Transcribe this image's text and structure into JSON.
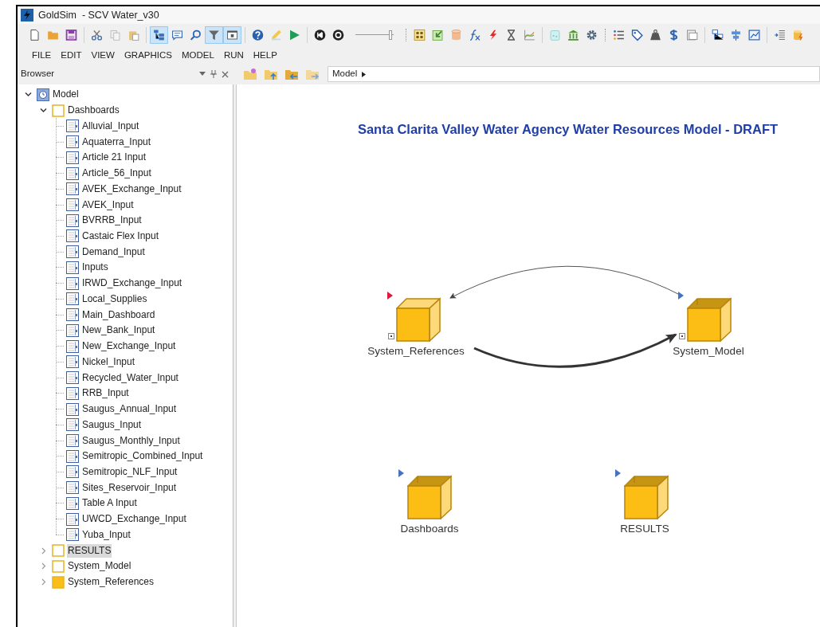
{
  "window": {
    "title": "GoldSim  - SCV Water_v30"
  },
  "toolbar_buttons": [
    {
      "selected": false
    },
    {
      "selected": false
    },
    {
      "selected": false
    },
    {
      "selected": false
    },
    {
      "selected": false
    },
    {
      "selected": false
    },
    {
      "selected": true
    },
    {
      "selected": false
    },
    {
      "selected": false
    },
    {
      "selected": true
    },
    {
      "selected": true
    },
    {
      "selected": false
    },
    {
      "selected": false
    },
    {
      "selected": false
    },
    {
      "selected": false
    },
    {
      "selected": false
    },
    {
      "selected": false
    },
    {
      "selected": false
    },
    {
      "selected": false
    },
    {
      "selected": false
    },
    {
      "selected": false
    },
    {
      "selected": false
    },
    {
      "selected": false
    },
    {
      "selected": false
    },
    {
      "selected": false
    },
    {
      "selected": false
    },
    {
      "selected": false
    },
    {
      "selected": false
    },
    {
      "selected": false
    },
    {
      "selected": false
    },
    {
      "selected": false
    },
    {
      "selected": false
    },
    {
      "selected": false
    },
    {
      "selected": false
    },
    {
      "selected": false
    },
    {
      "selected": false
    }
  ],
  "speed_slider": {
    "level": 0.95
  },
  "menu": [
    "FILE",
    "EDIT",
    "VIEW",
    "GRAPHICS",
    "MODEL",
    "RUN",
    "HELP"
  ],
  "browser": {
    "title": "Browser",
    "tree": [
      {
        "label": "Model",
        "kind": "model",
        "expanded": true,
        "selected": false,
        "children": [
          {
            "label": "Dashboards",
            "kind": "container",
            "filled": false,
            "expanded": true,
            "selected": false,
            "children": [
              {
                "label": "Alluvial_Input",
                "kind": "dashboard",
                "selected": false
              },
              {
                "label": "Aquaterra_Input",
                "kind": "dashboard",
                "selected": false
              },
              {
                "label": "Article 21 Input",
                "kind": "dashboard",
                "selected": false
              },
              {
                "label": "Article_56_Input",
                "kind": "dashboard",
                "selected": false
              },
              {
                "label": "AVEK_Exchange_Input",
                "kind": "dashboard",
                "selected": false
              },
              {
                "label": "AVEK_Input",
                "kind": "dashboard",
                "selected": false
              },
              {
                "label": "BVRRB_Input",
                "kind": "dashboard",
                "selected": false
              },
              {
                "label": "Castaic Flex Input",
                "kind": "dashboard",
                "selected": false
              },
              {
                "label": "Demand_Input",
                "kind": "dashboard",
                "selected": false
              },
              {
                "label": "Inputs",
                "kind": "dashboard",
                "selected": false
              },
              {
                "label": "IRWD_Exchange_Input",
                "kind": "dashboard",
                "selected": false
              },
              {
                "label": "Local_Supplies",
                "kind": "dashboard",
                "selected": false
              },
              {
                "label": "Main_Dashboard",
                "kind": "dashboard",
                "selected": false
              },
              {
                "label": "New_Bank_Input",
                "kind": "dashboard",
                "selected": false
              },
              {
                "label": "New_Exchange_Input",
                "kind": "dashboard",
                "selected": false
              },
              {
                "label": "Nickel_Input",
                "kind": "dashboard",
                "selected": false
              },
              {
                "label": "Recycled_Water_Input",
                "kind": "dashboard",
                "selected": false
              },
              {
                "label": "RRB_Input",
                "kind": "dashboard",
                "selected": false
              },
              {
                "label": "Saugus_Annual_Input",
                "kind": "dashboard",
                "selected": false
              },
              {
                "label": "Saugus_Input",
                "kind": "dashboard",
                "selected": false
              },
              {
                "label": "Saugus_Monthly_Input",
                "kind": "dashboard",
                "selected": false
              },
              {
                "label": "Semitropic_Combined_Input",
                "kind": "dashboard",
                "selected": false
              },
              {
                "label": "Semitropic_NLF_Input",
                "kind": "dashboard",
                "selected": false
              },
              {
                "label": "Sites_Reservoir_Input",
                "kind": "dashboard",
                "selected": false
              },
              {
                "label": "Table A Input",
                "kind": "dashboard",
                "selected": false
              },
              {
                "label": "UWCD_Exchange_Input",
                "kind": "dashboard",
                "selected": false
              },
              {
                "label": "Yuba_Input",
                "kind": "dashboard",
                "selected": false
              }
            ]
          },
          {
            "label": "RESULTS",
            "kind": "container",
            "filled": false,
            "expanded": false,
            "selected": true
          },
          {
            "label": "System_Model",
            "kind": "container",
            "filled": false,
            "expanded": false,
            "selected": false
          },
          {
            "label": "System_References",
            "kind": "container",
            "filled": true,
            "expanded": false,
            "selected": false
          }
        ]
      }
    ]
  },
  "breadcrumb": [
    "Model"
  ],
  "canvas": {
    "title": "Santa Clarita Valley Water Agency Water Resources Model - DRAFT",
    "nodes": [
      {
        "label": "System_References",
        "kind": "closed",
        "color": "#d81b3c",
        "pinned": true
      },
      {
        "label": "System_Model",
        "kind": "open",
        "color": "#4472c4",
        "pinned": true
      },
      {
        "label": "Dashboards",
        "kind": "open",
        "color": "#4472c4",
        "pinned": false
      },
      {
        "label": "RESULTS",
        "kind": "open",
        "color": "#4472c4",
        "pinned": false
      }
    ]
  }
}
